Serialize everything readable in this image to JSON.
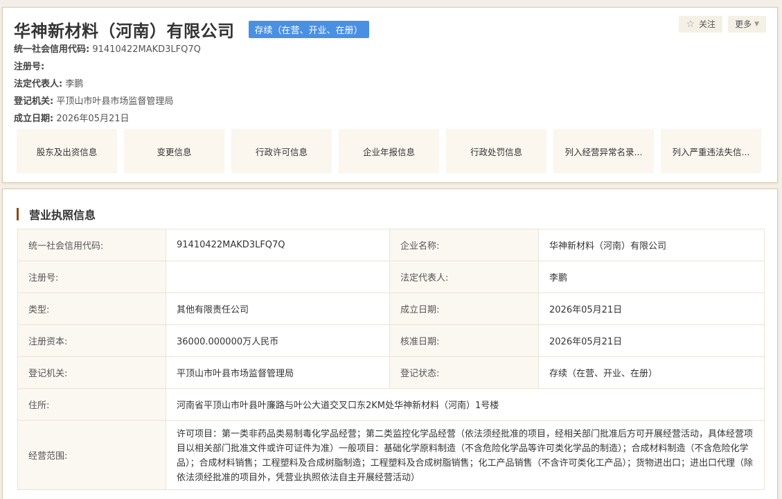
{
  "company": {
    "name": "华神新材料（河南）有限公司",
    "status": "存续（在营、开业、在册）"
  },
  "actions": {
    "follow_label": "关注",
    "more_label": "更多"
  },
  "summary": {
    "credit_code_label": "统一社会信用代码:",
    "credit_code": "91410422MAKD3LFQ7Q",
    "reg_no_label": "注册号:",
    "reg_no": "",
    "legal_rep_label": "法定代表人:",
    "legal_rep": "李鹏",
    "authority_label": "登记机关:",
    "authority": "平顶山市叶县市场监督管理局",
    "founded_label": "成立日期:",
    "founded": "2026年05月21日"
  },
  "tabs": [
    {
      "label": "股东及出资信息"
    },
    {
      "label": "变更信息"
    },
    {
      "label": "行政许可信息"
    },
    {
      "label": "企业年报信息"
    },
    {
      "label": "行政处罚信息"
    },
    {
      "label": "列入经营异常名录..."
    },
    {
      "label": "列入严重违法失信..."
    }
  ],
  "license": {
    "title": "营业执照信息",
    "rows": [
      {
        "l1": "统一社会信用代码:",
        "v1": "91410422MAKD3LFQ7Q",
        "l2": "企业名称:",
        "v2": "华神新材料（河南）有限公司"
      },
      {
        "l1": "注册号:",
        "v1": "",
        "l2": "法定代表人:",
        "v2": "李鹏"
      },
      {
        "l1": "类型:",
        "v1": "其他有限责任公司",
        "l2": "成立日期:",
        "v2": "2026年05月21日"
      },
      {
        "l1": "注册资本:",
        "v1": "36000.000000万人民币",
        "l2": "核准日期:",
        "v2": "2026年05月21日"
      },
      {
        "l1": "登记机关:",
        "v1": "平顶山市叶县市场监督管理局",
        "l2": "登记状态:",
        "v2": "存续（在营、开业、在册）"
      }
    ],
    "address_label": "住所:",
    "address": "河南省平顶山市叶县叶廉路与叶公大道交叉口东2KM处华神新材料（河南）1号楼",
    "scope_label": "经营范围:",
    "scope": "许可项目：第一类非药品类易制毒化学品经营；第二类监控化学品经营（依法须经批准的项目，经相关部门批准后方可开展经营活动，具体经营项目以相关部门批准文件或许可证件为准）一般项目：基础化学原料制造（不含危险化学品等许可类化学品的制造）；合成材料制造（不含危险化学品）；合成材料销售；工程塑料及合成树脂制造；工程塑料及合成树脂销售；化工产品销售（不含许可类化工产品）；货物进出口；进出口代理（除依法须经批准的项目外，凭营业执照依法自主开展经营活动）"
  }
}
